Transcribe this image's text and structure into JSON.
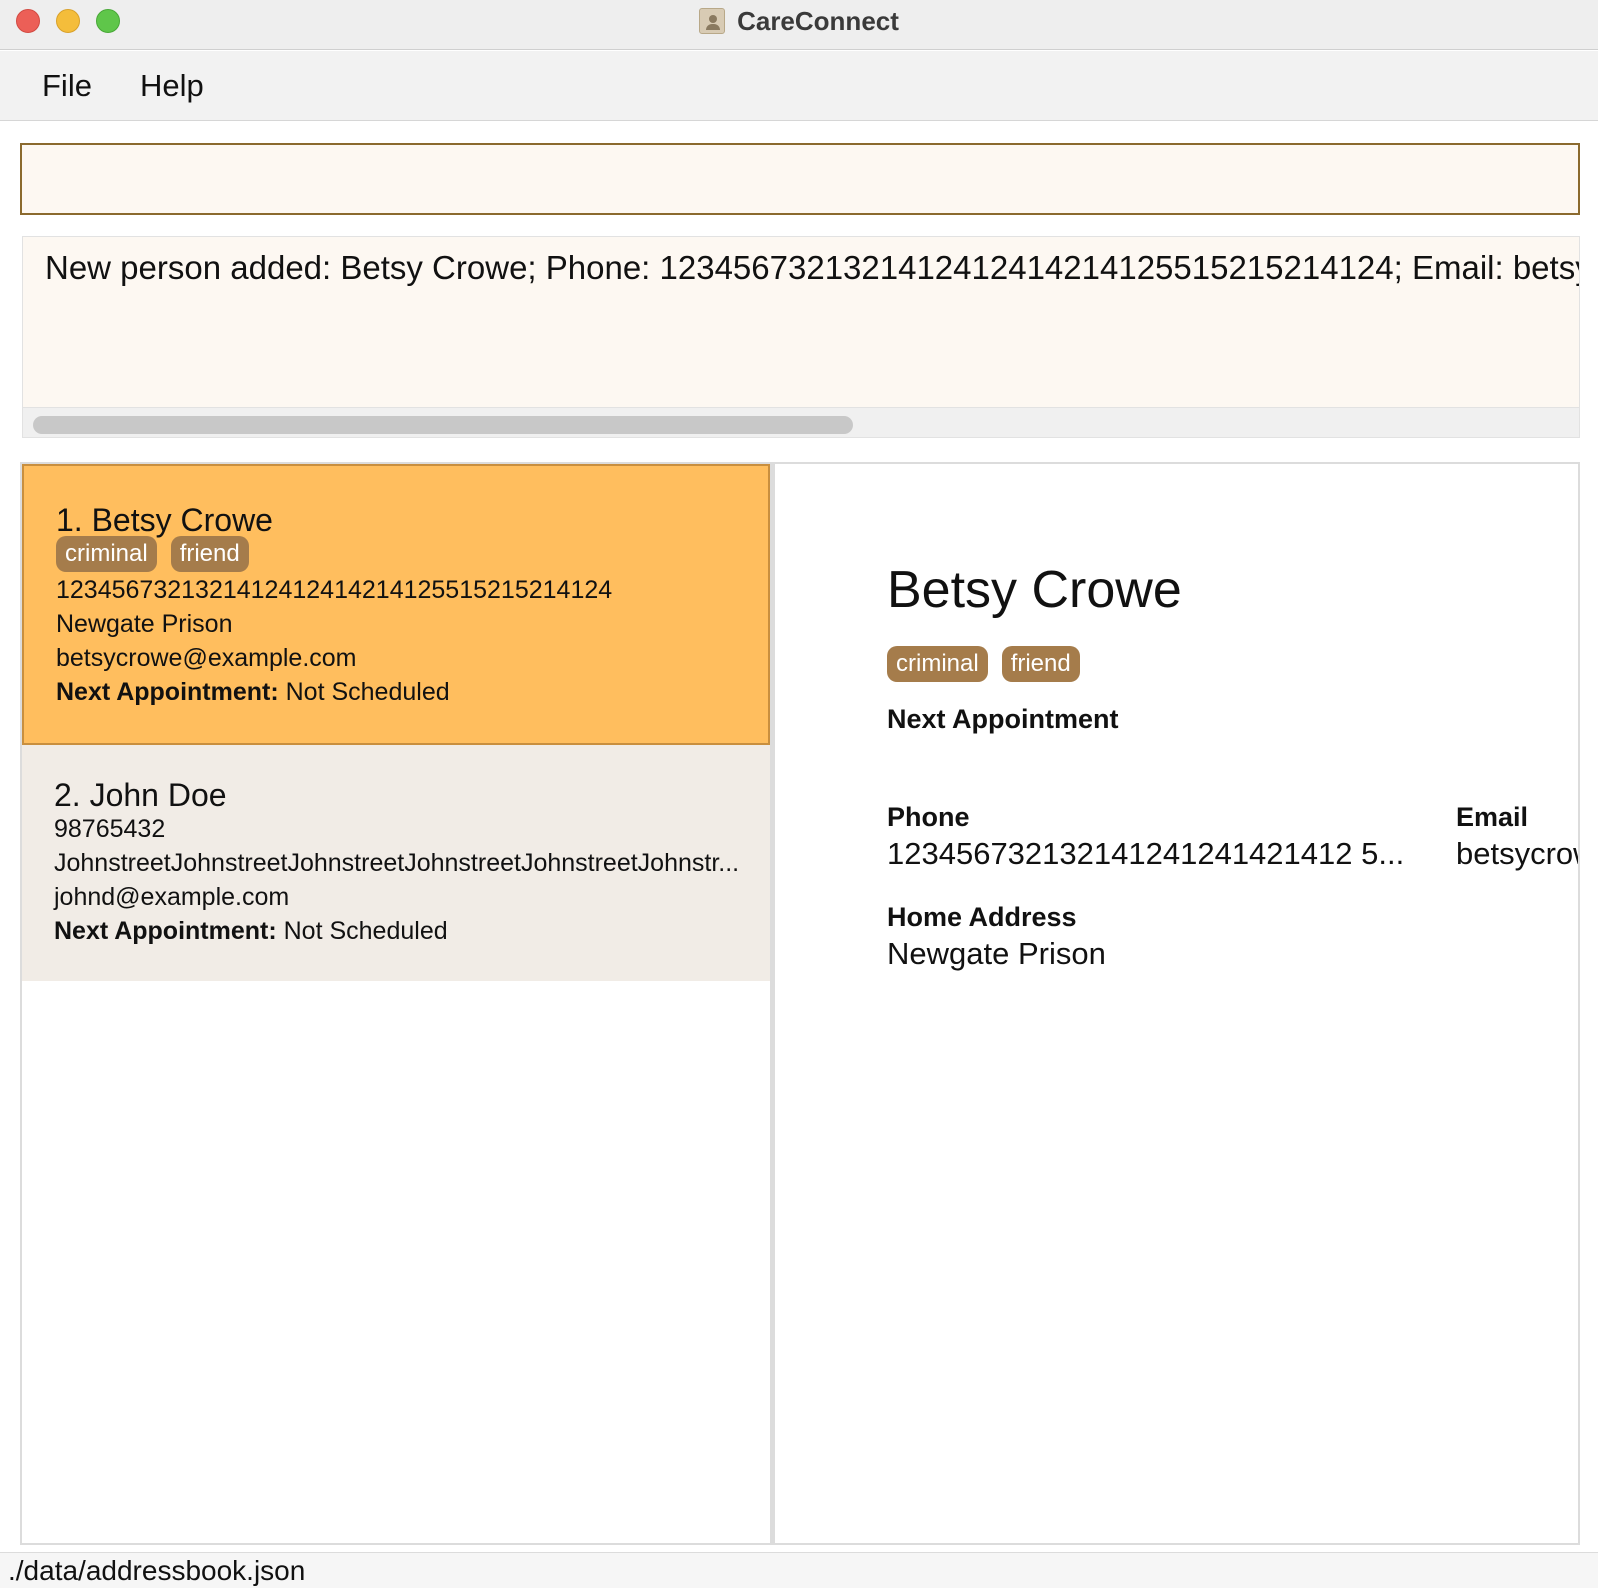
{
  "window": {
    "title": "CareConnect",
    "icon": "contact-book-icon"
  },
  "menu": {
    "items": [
      "File",
      "Help"
    ]
  },
  "command": {
    "value": "",
    "placeholder": ""
  },
  "result": {
    "text": "New person added: Betsy Crowe; Phone: 1234567321321412412414214125515215214124; Email: betsy"
  },
  "persons": [
    {
      "index_name": "1. Betsy Crowe",
      "tags": [
        "criminal",
        "friend"
      ],
      "phone": "1234567321321412412414214125515215214124",
      "address": "Newgate Prison",
      "email": "betsycrowe@example.com",
      "appointment_label": "Next Appointment:",
      "appointment_value": "Not Scheduled"
    },
    {
      "index_name": "2. John Doe",
      "tags": [],
      "phone": "98765432",
      "address": "JohnstreetJohnstreetJohnstreetJohnstreetJohnstreetJohnstr...",
      "email": "johnd@example.com",
      "appointment_label": "Next Appointment:",
      "appointment_value": "Not Scheduled"
    }
  ],
  "detail": {
    "name": "Betsy Crowe",
    "tags": [
      "criminal",
      "friend"
    ],
    "appointment_label": "Next Appointment",
    "phone_label": "Phone",
    "phone_value": "123456732132141241241421412 5...",
    "email_label": "Email",
    "email_value": "betsycrowe",
    "address_label": "Home Address",
    "address_value": "Newgate Prison"
  },
  "status": {
    "path": "./data/addressbook.json"
  },
  "colors": {
    "selected_card": "#ffbe5e",
    "card_bg": "#f1ece6",
    "tag_bg": "#a57c4b",
    "command_border": "#8b6a2e"
  }
}
